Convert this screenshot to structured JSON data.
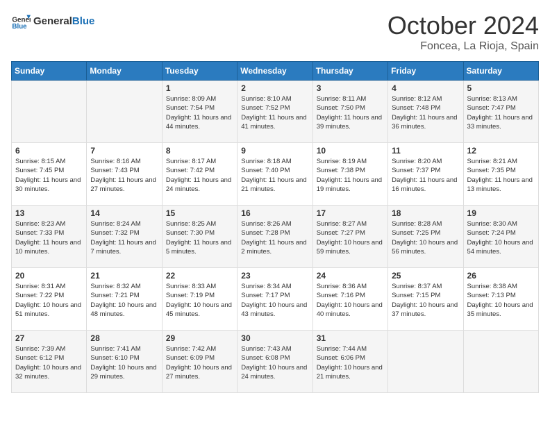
{
  "header": {
    "logo_line1": "General",
    "logo_line2": "Blue",
    "month": "October 2024",
    "location": "Foncea, La Rioja, Spain"
  },
  "weekdays": [
    "Sunday",
    "Monday",
    "Tuesday",
    "Wednesday",
    "Thursday",
    "Friday",
    "Saturday"
  ],
  "weeks": [
    [
      {
        "day": "",
        "info": ""
      },
      {
        "day": "",
        "info": ""
      },
      {
        "day": "1",
        "info": "Sunrise: 8:09 AM\nSunset: 7:54 PM\nDaylight: 11 hours and 44 minutes."
      },
      {
        "day": "2",
        "info": "Sunrise: 8:10 AM\nSunset: 7:52 PM\nDaylight: 11 hours and 41 minutes."
      },
      {
        "day": "3",
        "info": "Sunrise: 8:11 AM\nSunset: 7:50 PM\nDaylight: 11 hours and 39 minutes."
      },
      {
        "day": "4",
        "info": "Sunrise: 8:12 AM\nSunset: 7:48 PM\nDaylight: 11 hours and 36 minutes."
      },
      {
        "day": "5",
        "info": "Sunrise: 8:13 AM\nSunset: 7:47 PM\nDaylight: 11 hours and 33 minutes."
      }
    ],
    [
      {
        "day": "6",
        "info": "Sunrise: 8:15 AM\nSunset: 7:45 PM\nDaylight: 11 hours and 30 minutes."
      },
      {
        "day": "7",
        "info": "Sunrise: 8:16 AM\nSunset: 7:43 PM\nDaylight: 11 hours and 27 minutes."
      },
      {
        "day": "8",
        "info": "Sunrise: 8:17 AM\nSunset: 7:42 PM\nDaylight: 11 hours and 24 minutes."
      },
      {
        "day": "9",
        "info": "Sunrise: 8:18 AM\nSunset: 7:40 PM\nDaylight: 11 hours and 21 minutes."
      },
      {
        "day": "10",
        "info": "Sunrise: 8:19 AM\nSunset: 7:38 PM\nDaylight: 11 hours and 19 minutes."
      },
      {
        "day": "11",
        "info": "Sunrise: 8:20 AM\nSunset: 7:37 PM\nDaylight: 11 hours and 16 minutes."
      },
      {
        "day": "12",
        "info": "Sunrise: 8:21 AM\nSunset: 7:35 PM\nDaylight: 11 hours and 13 minutes."
      }
    ],
    [
      {
        "day": "13",
        "info": "Sunrise: 8:23 AM\nSunset: 7:33 PM\nDaylight: 11 hours and 10 minutes."
      },
      {
        "day": "14",
        "info": "Sunrise: 8:24 AM\nSunset: 7:32 PM\nDaylight: 11 hours and 7 minutes."
      },
      {
        "day": "15",
        "info": "Sunrise: 8:25 AM\nSunset: 7:30 PM\nDaylight: 11 hours and 5 minutes."
      },
      {
        "day": "16",
        "info": "Sunrise: 8:26 AM\nSunset: 7:28 PM\nDaylight: 11 hours and 2 minutes."
      },
      {
        "day": "17",
        "info": "Sunrise: 8:27 AM\nSunset: 7:27 PM\nDaylight: 10 hours and 59 minutes."
      },
      {
        "day": "18",
        "info": "Sunrise: 8:28 AM\nSunset: 7:25 PM\nDaylight: 10 hours and 56 minutes."
      },
      {
        "day": "19",
        "info": "Sunrise: 8:30 AM\nSunset: 7:24 PM\nDaylight: 10 hours and 54 minutes."
      }
    ],
    [
      {
        "day": "20",
        "info": "Sunrise: 8:31 AM\nSunset: 7:22 PM\nDaylight: 10 hours and 51 minutes."
      },
      {
        "day": "21",
        "info": "Sunrise: 8:32 AM\nSunset: 7:21 PM\nDaylight: 10 hours and 48 minutes."
      },
      {
        "day": "22",
        "info": "Sunrise: 8:33 AM\nSunset: 7:19 PM\nDaylight: 10 hours and 45 minutes."
      },
      {
        "day": "23",
        "info": "Sunrise: 8:34 AM\nSunset: 7:17 PM\nDaylight: 10 hours and 43 minutes."
      },
      {
        "day": "24",
        "info": "Sunrise: 8:36 AM\nSunset: 7:16 PM\nDaylight: 10 hours and 40 minutes."
      },
      {
        "day": "25",
        "info": "Sunrise: 8:37 AM\nSunset: 7:15 PM\nDaylight: 10 hours and 37 minutes."
      },
      {
        "day": "26",
        "info": "Sunrise: 8:38 AM\nSunset: 7:13 PM\nDaylight: 10 hours and 35 minutes."
      }
    ],
    [
      {
        "day": "27",
        "info": "Sunrise: 7:39 AM\nSunset: 6:12 PM\nDaylight: 10 hours and 32 minutes."
      },
      {
        "day": "28",
        "info": "Sunrise: 7:41 AM\nSunset: 6:10 PM\nDaylight: 10 hours and 29 minutes."
      },
      {
        "day": "29",
        "info": "Sunrise: 7:42 AM\nSunset: 6:09 PM\nDaylight: 10 hours and 27 minutes."
      },
      {
        "day": "30",
        "info": "Sunrise: 7:43 AM\nSunset: 6:08 PM\nDaylight: 10 hours and 24 minutes."
      },
      {
        "day": "31",
        "info": "Sunrise: 7:44 AM\nSunset: 6:06 PM\nDaylight: 10 hours and 21 minutes."
      },
      {
        "day": "",
        "info": ""
      },
      {
        "day": "",
        "info": ""
      }
    ]
  ]
}
